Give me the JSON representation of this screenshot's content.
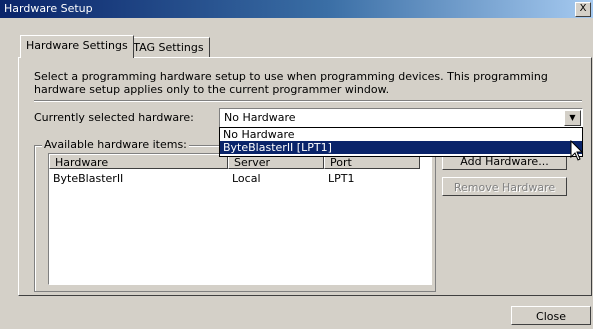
{
  "window": {
    "title": "Hardware Setup",
    "close_glyph": "X"
  },
  "tabs": [
    {
      "label": "Hardware Settings",
      "active": true
    },
    {
      "label": "JTAG Settings",
      "active": false
    }
  ],
  "description": "Select a programming hardware setup to use when programming devices. This programming hardware setup applies only to the current programmer window.",
  "current_hardware": {
    "label": "Currently selected hardware:",
    "value": "No Hardware",
    "options": [
      "No Hardware",
      "ByteBlasterII [LPT1]"
    ],
    "highlighted_option": "ByteBlasterII [LPT1]"
  },
  "available": {
    "legend": "Available hardware items:",
    "columns": [
      "Hardware",
      "Server",
      "Port"
    ],
    "rows": [
      {
        "hardware": "ByteBlasterII",
        "server": "Local",
        "port": "LPT1"
      }
    ]
  },
  "buttons": {
    "add": "Add Hardware...",
    "remove": "Remove Hardware",
    "close": "Close"
  }
}
